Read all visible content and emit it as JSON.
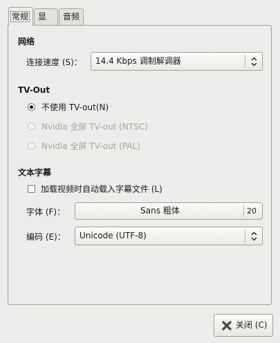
{
  "tabs": [
    {
      "label": "常规"
    },
    {
      "label": "显示"
    },
    {
      "label": "音频"
    }
  ],
  "network": {
    "title": "网络",
    "speed_label": "连接速度 (S)：",
    "speed_value": "14.4 Kbps 调制解调器"
  },
  "tvout": {
    "title": "TV-Out",
    "options": [
      {
        "label": "不使用  TV-out(N)",
        "checked": true,
        "enabled": true
      },
      {
        "label": "Nvidia 全屏  TV-out (NTSC)",
        "checked": false,
        "enabled": false
      },
      {
        "label": "Nvidia 全屏  TV-out (PAL)",
        "checked": false,
        "enabled": false
      }
    ]
  },
  "subtitles": {
    "title": "文本字幕",
    "autoload_label": "加载视频时自动载入字幕文件 (L)",
    "autoload_checked": false,
    "font_label": "字体 (F)：",
    "font_name": "Sans 粗体",
    "font_size": "20",
    "encoding_label": "编码 (E)：",
    "encoding_value": "Unicode (UTF-8)"
  },
  "buttons": {
    "close_label": "关闭 (C)"
  },
  "icons": {
    "updown": "updown-arrows-icon",
    "close": "close-x-icon"
  }
}
